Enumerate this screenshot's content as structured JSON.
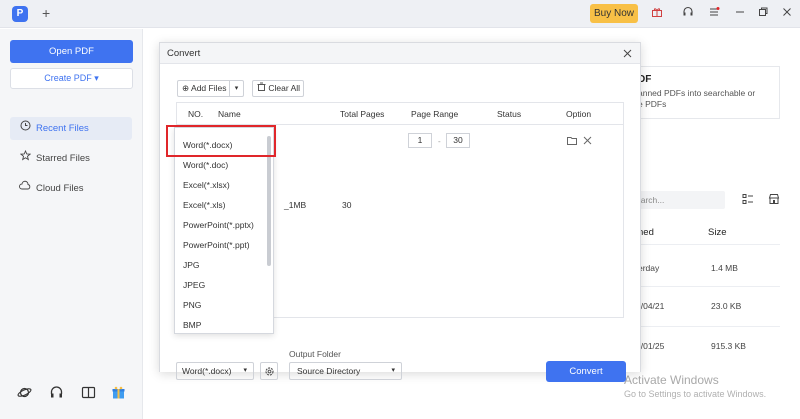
{
  "topbar": {
    "logo_glyph": "P",
    "new_tab_glyph": "+",
    "buy_now_label": "Buy Now",
    "icons": [
      "gift-icon",
      "headset-icon",
      "menu-icon",
      "minimize-icon",
      "restore-icon",
      "close-icon"
    ],
    "accent": "#3f73f0",
    "buy_color": "#f8c046"
  },
  "sidebar": {
    "open_pdf_label": "Open PDF",
    "create_pdf_label": "Create PDF ▾",
    "items": [
      {
        "label": "Recent Files",
        "icon": "clock-icon",
        "active": true
      },
      {
        "label": "Starred Files",
        "icon": "star-icon",
        "active": false
      },
      {
        "label": "Cloud Files",
        "icon": "cloud-icon",
        "active": false
      }
    ],
    "bottom_icons": [
      "planet-icon",
      "headset-icon",
      "book-icon",
      "gift-box-icon"
    ]
  },
  "right_panel": {
    "card_title": "DF",
    "card_desc_line1": "anned PDFs into searchable or",
    "card_desc_line2": "e PDFs",
    "search_placeholder": "earch...",
    "col_name": "ned",
    "col_size": "Size",
    "rows": [
      {
        "date": "erday",
        "size": "1.4 MB"
      },
      {
        "date": "5/04/21",
        "size": "23.0 KB"
      },
      {
        "date": "5/01/25",
        "size": "915.3 KB"
      }
    ],
    "watermark_line1": "Activate Windows",
    "watermark_line2": "Go to Settings to activate Windows."
  },
  "dialog": {
    "title": "Convert",
    "add_files_label": "Add Files",
    "clear_all_label": "Clear All",
    "columns": {
      "no": "NO.",
      "name": "Name",
      "total_pages": "Total Pages",
      "page_range": "Page Range",
      "status": "Status",
      "option": "Option"
    },
    "row": {
      "name_fragment": "_1MB",
      "total_pages": "30",
      "range_from": "1",
      "range_to": "30",
      "range_separator": "-"
    },
    "format_options": [
      "Word(*.docx)",
      "Word(*.doc)",
      "Excel(*.xlsx)",
      "Excel(*.xls)",
      "PowerPoint(*.pptx)",
      "PowerPoint(*.ppt)",
      "JPG",
      "JPEG",
      "PNG",
      "BMP"
    ],
    "highlighted_option": "Word(*.docx)",
    "output_folder_label": "Output Folder",
    "selected_format": "Word(*.docx)",
    "output_folder_value": "Source Directory",
    "convert_label": "Convert",
    "highlight_color": "#e0262a"
  }
}
